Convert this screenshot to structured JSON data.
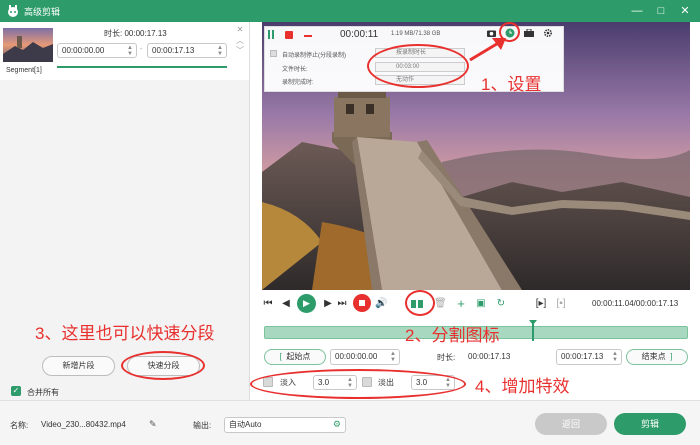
{
  "window": {
    "title": "高级剪辑"
  },
  "segment": {
    "duration_label": "时长:",
    "duration_value": "00:00:17.13",
    "start_time": "00:00:00.00",
    "end_time": "00:00:17.13",
    "name": "Segment[1]"
  },
  "left_actions": {
    "add_segment": "新增片段",
    "quick_split": "快速分段",
    "merge_all": "合并所有"
  },
  "recorder_toolbar": {
    "elapsed": "00:00:11",
    "size": "1.19 MB/71.38 GB"
  },
  "settings_panel": {
    "row1_label": "自动录制停止(分段录制)",
    "row1_value": "按录制时长",
    "row2_label": "文件时长:",
    "row2_value": "00:03:00",
    "row3_label": "录制完成时:",
    "row3_value": "无动作"
  },
  "player": {
    "time_readout": "00:00:11.04/00:00:17.13"
  },
  "cut": {
    "start_label": "起始点",
    "start_value": "00:00:00.00",
    "duration_label": "时长:",
    "duration_value": "00:00:17.13",
    "end_value": "00:00:17.13",
    "end_label": "结束点"
  },
  "fade": {
    "fade_in_label": "淡入",
    "fade_in_value": "3.0",
    "fade_out_label": "淡出",
    "fade_out_value": "3.0"
  },
  "bottom": {
    "name_label": "名称:",
    "file_name": "Video_230...80432.mp4",
    "output_label": "输出:",
    "output_value": "自动Auto",
    "back": "返回",
    "edit": "剪辑"
  },
  "annotations": {
    "a1": "1、设置",
    "a2": "2、分割图标",
    "a3": "3、这里也可以快速分段",
    "a4": "4、增加特效"
  },
  "colors": {
    "accent": "#2e9c6a",
    "annotation": "#e8312f"
  }
}
